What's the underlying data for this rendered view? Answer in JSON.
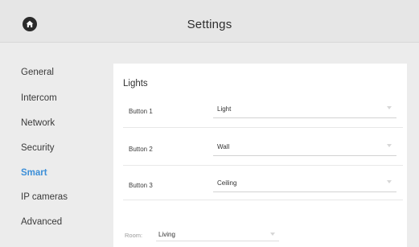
{
  "header": {
    "title": "Settings",
    "home_icon": "home-icon"
  },
  "sidebar": {
    "active_color": "#3c8fd8",
    "items": [
      {
        "label": "General"
      },
      {
        "label": "Intercom"
      },
      {
        "label": "Network"
      },
      {
        "label": "Security"
      },
      {
        "label": "Smart",
        "active": true
      },
      {
        "label": "IP cameras"
      },
      {
        "label": "Advanced"
      }
    ]
  },
  "main": {
    "section_title": "Lights",
    "rows": [
      {
        "label": "Button 1",
        "value": "Light"
      },
      {
        "label": "Button 2",
        "value": "Wall"
      },
      {
        "label": "Button 3",
        "value": "Ceiling"
      }
    ],
    "room": {
      "label": "Room:",
      "value": "Living"
    }
  }
}
